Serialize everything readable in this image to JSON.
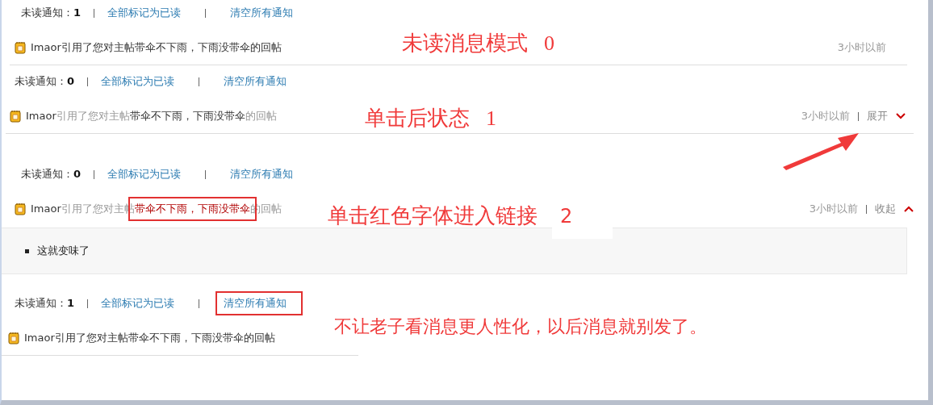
{
  "panels": [
    {
      "unread": "未读通知：**1**",
      "mark_all": "全部标记为已读",
      "clear_all": "清空所有通知",
      "clear_boxed": false,
      "notification": {
        "user": "Imaor",
        "before": "引用了您对主帖",
        "title": "带伞不下雨，下雨没带伞",
        "after": "的回帖",
        "read": false,
        "title_red": false,
        "title_boxed": false,
        "time": "3小时以前"
      },
      "annotation": {
        "text": "未读消息模式",
        "number": "0",
        "kind": "serif"
      }
    },
    {
      "unread": "未读通知：**0**",
      "mark_all": "全部标记为已读",
      "clear_all": "清空所有通知",
      "clear_boxed": false,
      "notification": {
        "user": "Imaor",
        "before": "引用了您对主帖",
        "title": "带伞不下雨，下雨没带伞",
        "after": "的回帖",
        "read": true,
        "title_red": false,
        "title_boxed": false,
        "time": "3小时以前",
        "toggle": {
          "label": "展开",
          "expanded": false
        }
      },
      "annotation": {
        "text": "单击后状态",
        "number": "1",
        "kind": "serif",
        "arrow": true
      }
    },
    {
      "unread": "未读通知：**0**",
      "mark_all": "全部标记为已读",
      "clear_all": "清空所有通知",
      "clear_boxed": false,
      "notification": {
        "user": "Imaor",
        "before": "引用了您对主帖",
        "title": "带伞不下雨，下雨没带伞",
        "after": "的回帖",
        "read": true,
        "title_red": true,
        "title_boxed": true,
        "time": "3小时以前",
        "toggle": {
          "label": "收起",
          "expanded": true
        },
        "detail": "这就变味了"
      },
      "annotation": {
        "text": "单击红色字体进入链接",
        "number": "2",
        "kind": "serif"
      }
    },
    {
      "unread": "未读通知：**1**",
      "mark_all": "全部标记为已读",
      "clear_all": "清空所有通知",
      "clear_boxed": true,
      "notification": {
        "user": "Imaor",
        "before": "引用了您对主帖",
        "title": "带伞不下雨，下雨没带伞",
        "after": "的回帖",
        "read": false,
        "title_red": false,
        "title_boxed": false
      },
      "annotation": {
        "text": "不让老子看消息更人性化，以后消息就别发了。",
        "kind": "sans"
      }
    }
  ]
}
